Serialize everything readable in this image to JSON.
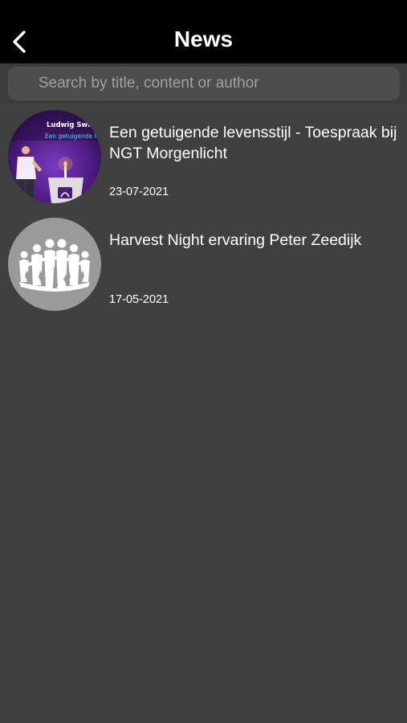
{
  "header": {
    "title": "News",
    "back_icon": "chevron-left-icon"
  },
  "search": {
    "placeholder": "Search by title, content or author",
    "value": ""
  },
  "news": [
    {
      "title": "Een getuigende levensstijl - Toespraak bij NGT Morgenlicht",
      "date": "23-07-2021",
      "thumbnail": {
        "line1": "Ludwig Swin",
        "line2": "Een getuigende leve"
      }
    },
    {
      "title": "Harvest Night ervaring Peter Zeedijk",
      "date": "17-05-2021",
      "thumbnail": {
        "icon": "people-circle-icon"
      }
    }
  ],
  "colors": {
    "background": "#404040",
    "nav_background": "#000000",
    "search_field": "#4d4d4d",
    "placeholder": "#a0a0a0",
    "thumb_purple": "#5a1f8a",
    "thumb_gray": "#9a9a9a"
  }
}
